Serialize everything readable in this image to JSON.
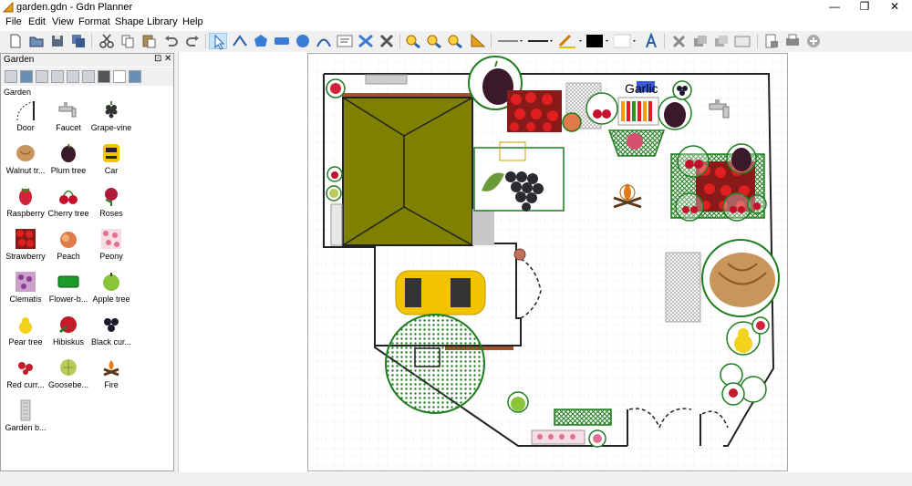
{
  "window": {
    "title": "garden.gdn - Gdn Planner",
    "minimize_glyph": "—",
    "maximize_glyph": "❐",
    "close_glyph": "✕"
  },
  "menu": {
    "file": "File",
    "edit": "Edit",
    "view": "View",
    "format": "Format",
    "shape": "Shape",
    "library": "Library",
    "help": "Help"
  },
  "panel": {
    "title": "Garden",
    "pin_glyph": "⊡",
    "close_glyph": "✕",
    "category": "Garden",
    "items": [
      {
        "label": "Door",
        "icon": "door-icon"
      },
      {
        "label": "Faucet",
        "icon": "faucet-icon"
      },
      {
        "label": "Grape-vine",
        "icon": "grape-icon"
      },
      {
        "label": "Walnut tr...",
        "icon": "walnut-icon"
      },
      {
        "label": "Plum tree",
        "icon": "plum-icon"
      },
      {
        "label": "Car",
        "icon": "car-icon"
      },
      {
        "label": "Raspberry",
        "icon": "raspberry-icon"
      },
      {
        "label": "Cherry tree",
        "icon": "cherry-icon"
      },
      {
        "label": "Roses",
        "icon": "rose-icon"
      },
      {
        "label": "Strawberry",
        "icon": "strawberry-icon"
      },
      {
        "label": "Peach",
        "icon": "peach-icon"
      },
      {
        "label": "Peony",
        "icon": "peony-icon"
      },
      {
        "label": "Clematis",
        "icon": "clematis-icon"
      },
      {
        "label": "Flower-b...",
        "icon": "flowerbed-icon"
      },
      {
        "label": "Apple tree",
        "icon": "apple-icon"
      },
      {
        "label": "Pear tree",
        "icon": "pear-icon"
      },
      {
        "label": "Hibiskus",
        "icon": "hibiscus-icon"
      },
      {
        "label": "Black cur...",
        "icon": "blackcurrant-icon"
      },
      {
        "label": "Red curr...",
        "icon": "redcurrant-icon"
      },
      {
        "label": "Goosebe...",
        "icon": "gooseberry-icon"
      },
      {
        "label": "Fire",
        "icon": "fire-icon"
      },
      {
        "label": "Garden b...",
        "icon": "garden-bench-icon"
      }
    ]
  },
  "canvas": {
    "garlic_label": "Garlic"
  },
  "colors": {
    "roof": "#808000",
    "car": "#f2c400",
    "plant_outline": "#1e7d1e",
    "wall": "#222222",
    "beam": "#a0522d"
  }
}
